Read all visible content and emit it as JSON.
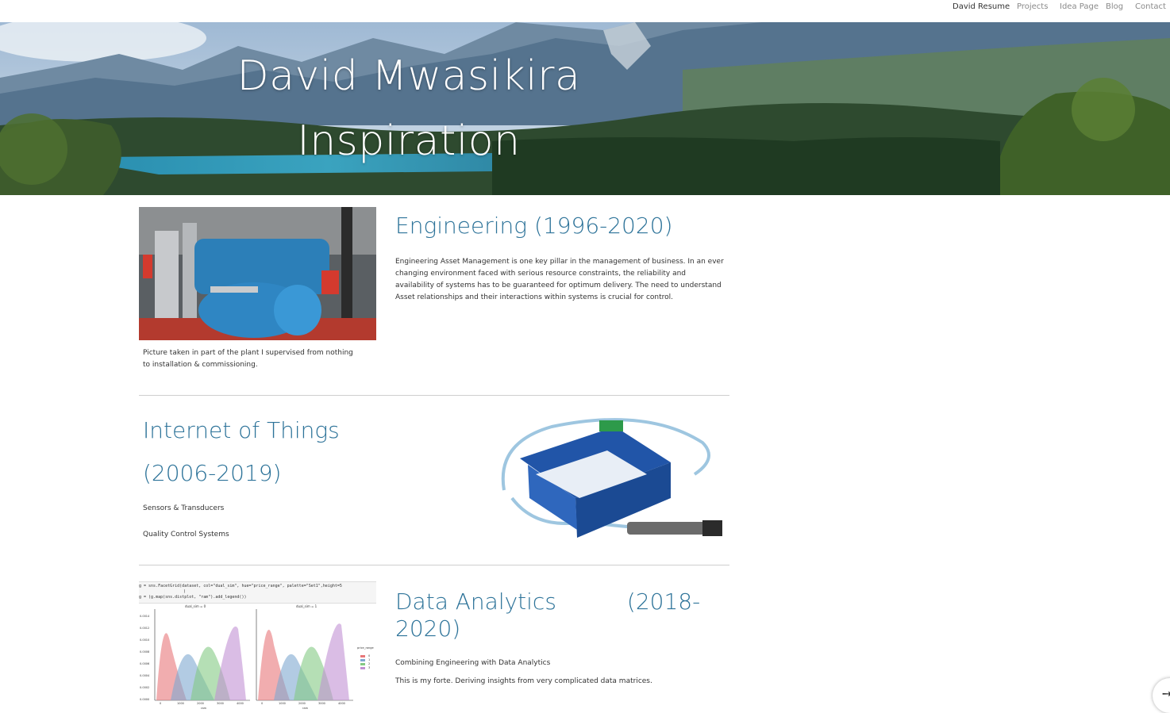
{
  "nav": {
    "items": [
      "David Resume",
      "Projects",
      "Idea Page",
      "Blog",
      "Contact"
    ],
    "active_index": 0
  },
  "hero": {
    "title_line1": "David Mwasikira",
    "title_line2": "Inspiration"
  },
  "engineering": {
    "title": "Engineering (1996-2020)",
    "body": "Engineering Asset Management is one key pillar in the management of business. In an ever changing environment faced with serious resource constraints, the reliability and availability of systems has to be guaranteed for optimum delivery. The need to understand Asset relationships and their interactions within systems is crucial for control.",
    "caption": "Picture taken in  part of the plant I supervised from nothing to installation & commissioning."
  },
  "iot": {
    "title_line1": "Internet of Things",
    "title_line2": "(2006-2019)",
    "item1": "Sensors & Transducers",
    "item2": "Quality Control Systems"
  },
  "analytics": {
    "title_line1": "Data Analytics          (2018-",
    "title_line2": "2020)",
    "line1": "Combining Engineering with Data Analytics",
    "line2": "This is my forte. Deriving insights from very complicated data matrices.",
    "code_line1": "g = sns.FacetGrid(dataset, col=\"dual_sim\", hue=\"price_range\", palette=\"Set1\",height=5",
    "code_line2": ")",
    "code_line3": "g = (g.map(sns.distplot, \"ram\").add_legend())",
    "facet1": "dual_sim = 0",
    "facet2": "dual_sim = 1",
    "legend_title": "price_range",
    "legend_items": [
      "0",
      "1",
      "2",
      "3"
    ],
    "xlabel": "ram",
    "yticks": [
      "0.0014",
      "0.0012",
      "0.0010",
      "0.0008",
      "0.0006",
      "0.0004",
      "0.0002",
      "0.0000"
    ],
    "xticks": [
      "0",
      "1000",
      "2000",
      "3000",
      "4000"
    ]
  },
  "colors": {
    "heading": "#2d7399",
    "series": [
      "#e8777a",
      "#7fa8d1",
      "#84c984",
      "#c191d3"
    ]
  }
}
